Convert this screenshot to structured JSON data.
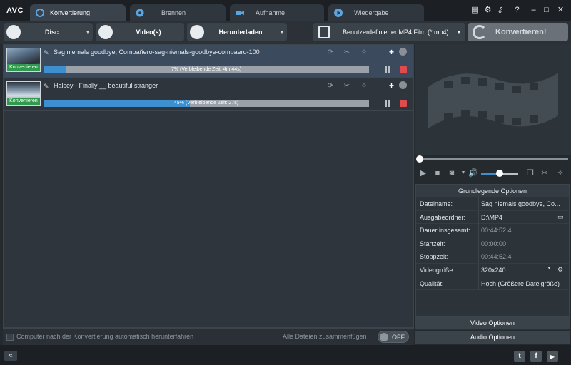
{
  "app": {
    "logo": "AVC"
  },
  "tabs": [
    {
      "label": "Konvertierung"
    },
    {
      "label": "Brennen"
    },
    {
      "label": "Aufnahme"
    },
    {
      "label": "Wiedergabe"
    }
  ],
  "toolbar": {
    "disc_label": "Disc",
    "videos_label": "Video(s)",
    "download_label": "Herunterladen",
    "format_label": "Benutzerdefinierter MP4 Film (*.mp4)",
    "convert_label": "Konvertieren!"
  },
  "items": [
    {
      "thumb_label": "Konvertieren",
      "title": "Sag niemals goodbye, Compañero-sag-niemals-goodbye-compaero-100",
      "progress": 0.07,
      "progress_text": "7% (Verbleibende Zeit: 4m 44s)"
    },
    {
      "thumb_label": "Konvertieren",
      "title": "Halsey - Finally __ beautiful stranger",
      "progress": 0.45,
      "progress_text": "45% (Verbleibende Zeit: 27s)"
    }
  ],
  "footer": {
    "shutdown_label": "Computer nach der Konvertierung automatisch herunterfahren",
    "merge_label": "Alle Dateien zusammenfügen",
    "toggle_label": "OFF"
  },
  "player": {
    "volume": 0.5
  },
  "options": {
    "header": "Grundlegende Optionen",
    "rows": [
      {
        "key": "Dateiname:",
        "value": "Sag niemals goodbye, Co..."
      },
      {
        "key": "Ausgabeordner:",
        "value": "D:\\MP4"
      },
      {
        "key": "Dauer insgesamt:",
        "value": "00:44:52.4"
      },
      {
        "key": "Startzeit:",
        "value": "00:00:00"
      },
      {
        "key": "Stoppzeit:",
        "value": "00:44:52.4"
      },
      {
        "key": "Videogröße:",
        "value": "320x240"
      },
      {
        "key": "Qualität:",
        "value": "Hoch (Größere Dateigröße)"
      }
    ],
    "video_button": "Video Optionen",
    "audio_button": "Audio Optionen"
  },
  "statusbar": {
    "back_label": "«",
    "twitter_label": "t",
    "facebook_label": "f"
  },
  "colors": {
    "accent": "#3d8fd0",
    "progress_bg": "#9aa1a8",
    "stop_red": "#e14b4b",
    "thumb_green": "#2f9a4d"
  }
}
